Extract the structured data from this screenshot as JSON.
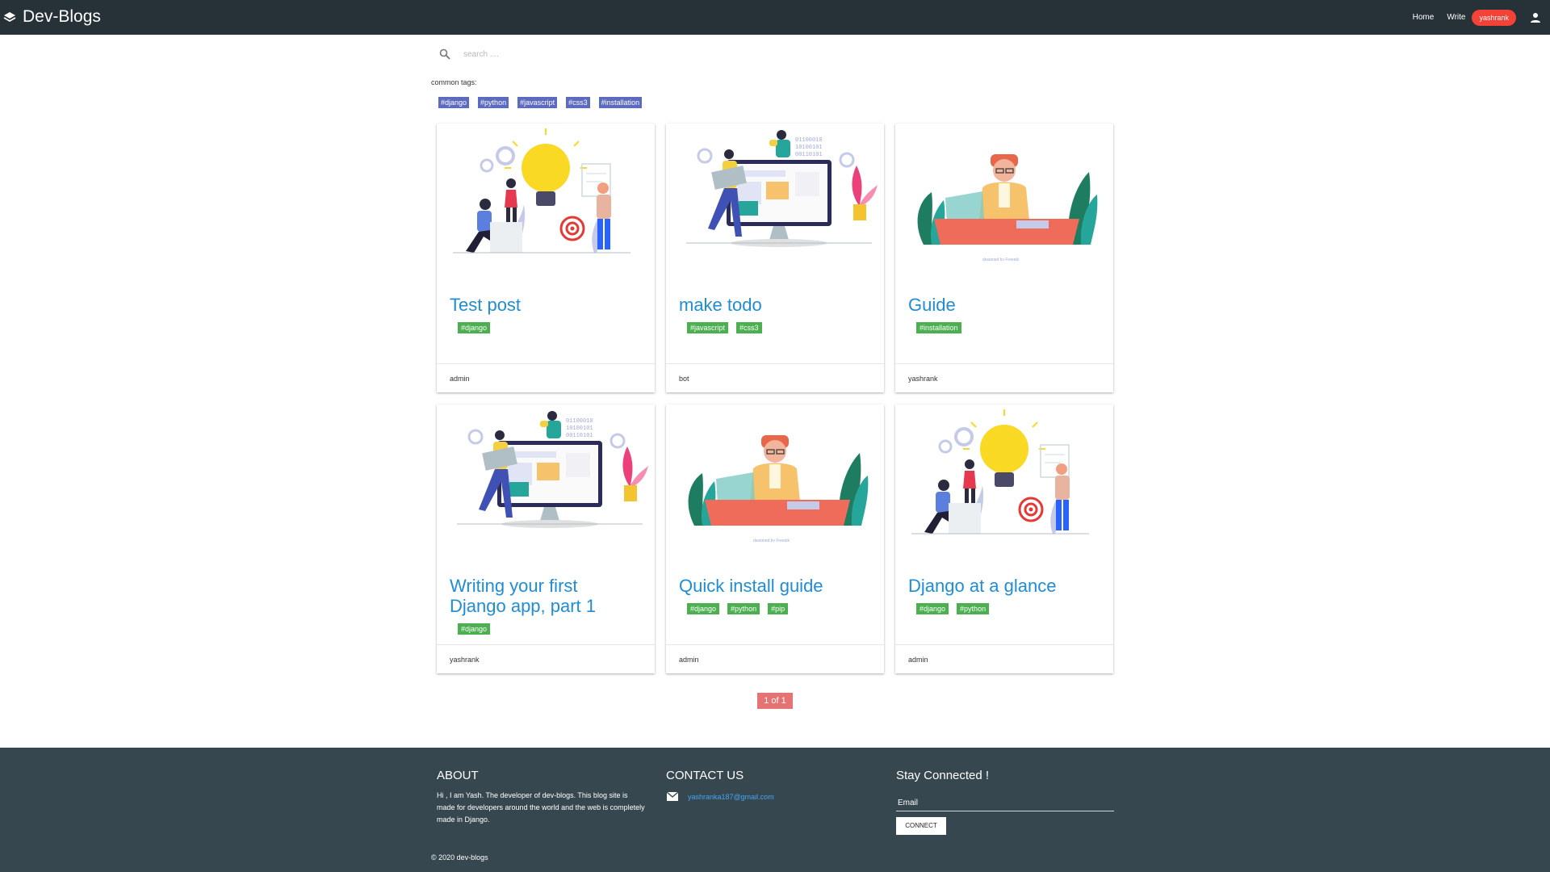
{
  "navbar": {
    "brand": "Dev-Blogs",
    "links": [
      "Home",
      "Write"
    ],
    "user": "yashrank"
  },
  "search": {
    "placeholder": "search ...."
  },
  "tags_section": {
    "label": "common tags:",
    "tags": [
      "#django",
      "#python",
      "#javascript",
      "#css3",
      "#installation"
    ]
  },
  "posts": [
    {
      "title": "Test post",
      "tags": [
        "#django"
      ],
      "author": "admin",
      "illustration": "idea-bulb-team"
    },
    {
      "title": "make todo",
      "tags": [
        "#javascript",
        "#css3"
      ],
      "author": "bot",
      "illustration": "computer-team"
    },
    {
      "title": "Guide",
      "tags": [
        "#installation"
      ],
      "author": "yashrank",
      "illustration": "man-at-desk"
    },
    {
      "title": "Writing your first Django app, part 1",
      "tags": [
        "#django"
      ],
      "author": "yashrank",
      "illustration": "computer-team"
    },
    {
      "title": "Quick install guide",
      "tags": [
        "#django",
        "#python",
        "#pip"
      ],
      "author": "admin",
      "illustration": "man-at-desk"
    },
    {
      "title": "Django at a glance",
      "tags": [
        "#django",
        "#python"
      ],
      "author": "admin",
      "illustration": "idea-bulb-team"
    }
  ],
  "pagination": {
    "label": "1 of 1"
  },
  "footer": {
    "about_title": "ABOUT",
    "about_text": "Hi , I am Yash. The developer of dev-blogs. This blog site is made for developers around the world and the web is completely made in Django.",
    "contact_title": "CONTACT US",
    "contact_email": "yashranka187@gmail.com",
    "stay_title": "Stay Connected !",
    "email_placeholder": "Email",
    "connect_label": "CONNECT",
    "copyright": "© 2020 dev-blogs"
  },
  "colors": {
    "navbar": "#263238",
    "footer": "#37474f",
    "common_tag": "#5c6bc0",
    "post_tag": "#4caf50",
    "title": "#1f8dd6",
    "user_badge": "#f44336",
    "pagination": "#e57373"
  }
}
